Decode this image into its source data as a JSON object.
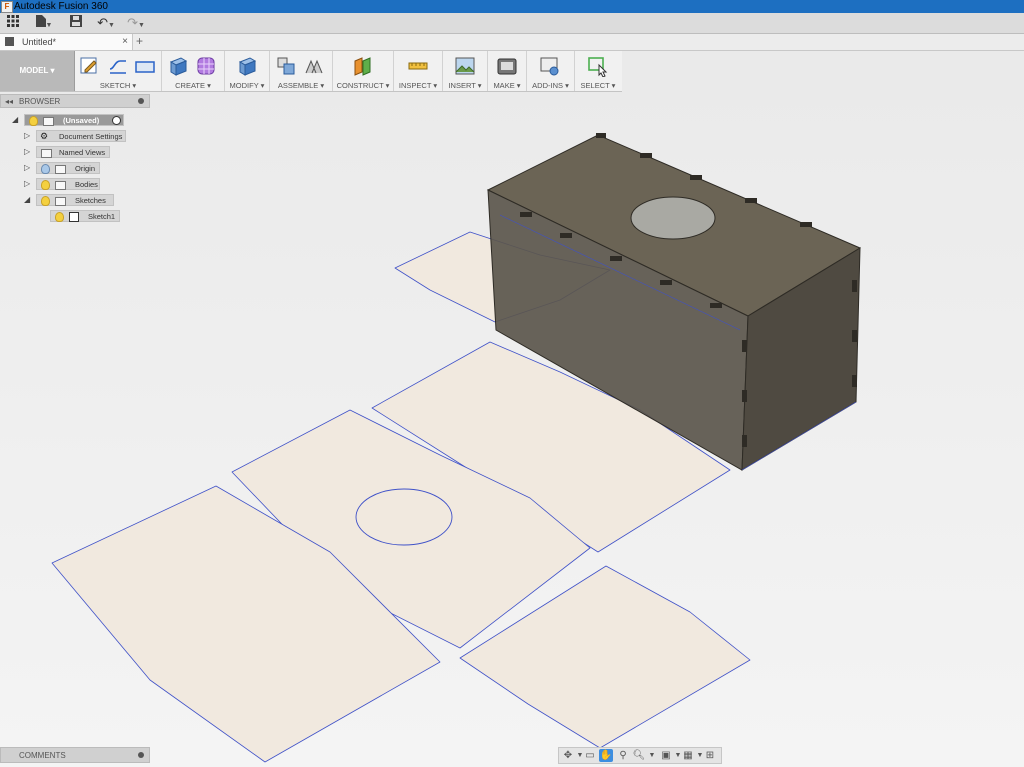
{
  "window": {
    "title": "Autodesk Fusion 360"
  },
  "qat": {
    "grid_icon": "app-grid-icon",
    "file_icon": "file-icon",
    "save_icon": "save-icon",
    "undo_icon": "undo-icon",
    "redo_icon": "redo-icon"
  },
  "tabs": [
    {
      "label": "Untitled*"
    }
  ],
  "toolbar": {
    "workspace_label": "MODEL ▾",
    "groups": [
      {
        "label": "SKETCH ▾"
      },
      {
        "label": "CREATE ▾"
      },
      {
        "label": "MODIFY ▾"
      },
      {
        "label": "ASSEMBLE ▾"
      },
      {
        "label": "CONSTRUCT ▾"
      },
      {
        "label": "INSPECT ▾"
      },
      {
        "label": "INSERT ▾"
      },
      {
        "label": "MAKE ▾"
      },
      {
        "label": "ADD-INS ▾"
      },
      {
        "label": "SELECT ▾"
      }
    ]
  },
  "browser": {
    "title": "BROWSER",
    "root": "(Unsaved)",
    "items": [
      {
        "label": "Document Settings"
      },
      {
        "label": "Named Views"
      },
      {
        "label": "Origin"
      },
      {
        "label": "Bodies"
      },
      {
        "label": "Sketches"
      },
      {
        "label": "Sketch1"
      }
    ]
  },
  "comments": {
    "title": "COMMENTS"
  },
  "colors": {
    "titlebar": "#1d6fc1",
    "sketch_fill": "#f1e9df",
    "sketch_line": "#3f51c8",
    "body": "#5e584c",
    "accent_select": "#4caf50"
  }
}
